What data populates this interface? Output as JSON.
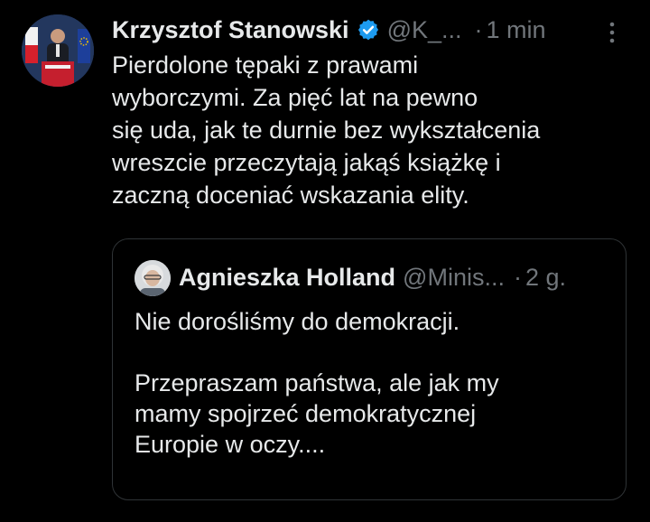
{
  "tweet": {
    "display_name": "Krzysztof Stanowski",
    "handle": "@K_...",
    "separator": "·",
    "time": "1 min",
    "verified_icon": "verified-badge-icon",
    "more_icon": "more-options-icon",
    "text_lines": [
      "Pierdolone tępaki z prawami",
      "wyborczymi. Za pięć lat na pewno",
      "się uda, jak te durnie bez wykształcenia",
      "wreszcie przeczytają jakąś książkę i",
      "zaczną doceniać wskazania elity."
    ]
  },
  "quote": {
    "display_name": "Agnieszka Holland",
    "handle": "@Minis...",
    "separator": "·",
    "time": "2 g.",
    "text_lines": [
      "Nie dorośliśmy do demokracji.",
      "",
      "Przepraszam państwa, ale jak my",
      "mamy spojrzeć demokratycznej",
      "Europie w oczy...."
    ]
  },
  "colors": {
    "background": "#000000",
    "text": "#e7e9ea",
    "muted": "#71767b",
    "border": "#2f3336",
    "verified": "#1d9bf0"
  }
}
